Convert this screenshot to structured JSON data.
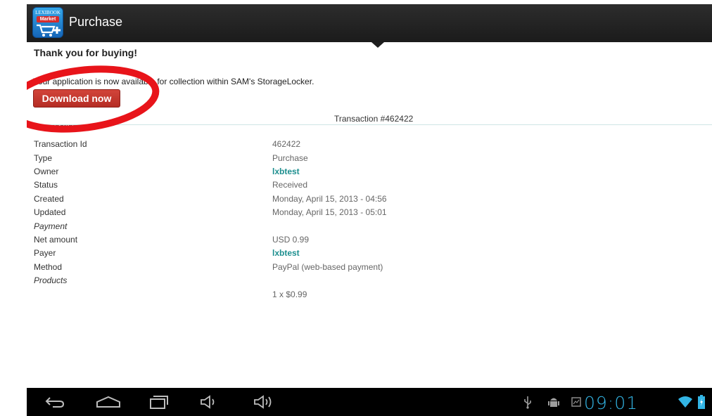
{
  "app": {
    "icon_line1": "LEXIBOOK",
    "icon_line2": "Market",
    "title": "Purchase"
  },
  "content": {
    "heading": "Thank you for buying!",
    "availability_text": "Your application is now available for collection within SAM's StorageLocker.",
    "download_label": "Download now",
    "transaction_header": "Transaction #462422"
  },
  "details": {
    "section_transaction": "Transaction",
    "rows_transaction": [
      {
        "label": "Transaction Id",
        "value": "462422"
      },
      {
        "label": "Type",
        "value": "Purchase"
      },
      {
        "label": "Owner",
        "value": "lxbtest"
      },
      {
        "label": "Status",
        "value": "Received"
      },
      {
        "label": "Created",
        "value": "Monday, April 15, 2013 - 04:56"
      },
      {
        "label": "Updated",
        "value": "Monday, April 15, 2013 - 05:01"
      }
    ],
    "section_payment": "Payment",
    "rows_payment": [
      {
        "label": "Net amount",
        "value": "USD 0.99"
      },
      {
        "label": "Payer",
        "value": "lxbtest"
      },
      {
        "label": "Method",
        "value": "PayPal (web-based payment)"
      }
    ],
    "section_products": "Products",
    "product_line": "1 x $0.99"
  },
  "status_bar": {
    "time": "09:01",
    "accent_color": "#33b5e5"
  },
  "colors": {
    "link": "#1d8f8f",
    "button": "#c0392b",
    "annotation": "#e8141a"
  },
  "icons": [
    "back-icon",
    "home-icon",
    "recent-apps-icon",
    "volume-down-icon",
    "volume-up-icon",
    "usb-icon",
    "android-debug-icon",
    "screenshot-icon",
    "wifi-icon",
    "battery-icon",
    "shopping-cart-icon"
  ]
}
